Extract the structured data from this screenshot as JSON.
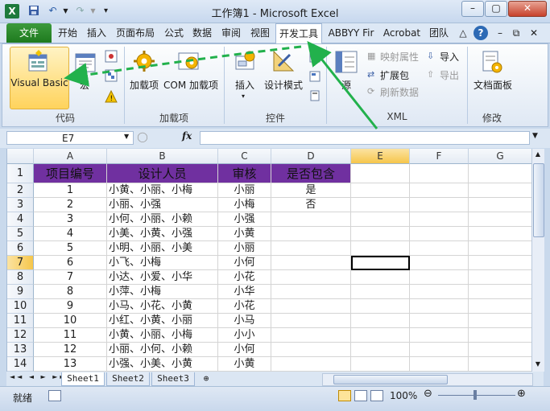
{
  "window": {
    "title": "工作簿1 - Microsoft Excel",
    "minimize": "–",
    "restore": "▢",
    "close": "✕"
  },
  "tabs": [
    "文件",
    "开始",
    "插入",
    "页面布局",
    "公式",
    "数据",
    "审阅",
    "视图",
    "开发工具",
    "ABBYY Fir",
    "Acrobat",
    "团队"
  ],
  "ribbon": {
    "groups": {
      "code": {
        "label": "代码",
        "visual_basic": "Visual Basic",
        "macros": "宏"
      },
      "addins": {
        "label": "加载项",
        "addins": "加载项",
        "com_addins": "COM 加载项"
      },
      "controls": {
        "label": "控件",
        "insert": "插入",
        "design_mode": "设计模式"
      },
      "xml": {
        "label": "XML",
        "source": "源",
        "map_properties": "映射属性",
        "expansion_packs": "扩展包",
        "refresh_data": "刷新数据",
        "import": "导入",
        "export": "导出"
      },
      "modify": {
        "label": "修改",
        "document_panel": "文档面板"
      }
    }
  },
  "formula_bar": {
    "name_box": "E7",
    "fx": "fx",
    "value": ""
  },
  "grid": {
    "columns": [
      "A",
      "B",
      "C",
      "D",
      "E",
      "F",
      "G"
    ],
    "rows": [
      "1",
      "2",
      "3",
      "4",
      "5",
      "6",
      "7",
      "8",
      "9",
      "10",
      "11",
      "12",
      "13",
      "14"
    ],
    "headers": [
      "项目编号",
      "设计人员",
      "审核",
      "是否包含"
    ],
    "data": [
      [
        "1",
        "小黄、小丽、小梅",
        "小丽",
        "是"
      ],
      [
        "2",
        "小丽、小强",
        "小梅",
        "否"
      ],
      [
        "3",
        "小何、小丽、小赖",
        "小强",
        ""
      ],
      [
        "4",
        "小美、小黄、小强",
        "小黄",
        ""
      ],
      [
        "5",
        "小明、小丽、小美",
        "小丽",
        ""
      ],
      [
        "6",
        "小飞、小梅",
        "小何",
        ""
      ],
      [
        "7",
        "小达、小爱、小华",
        "小花",
        ""
      ],
      [
        "8",
        "小萍、小梅",
        "小华",
        ""
      ],
      [
        "9",
        "小马、小花、小黄",
        "小花",
        ""
      ],
      [
        "10",
        "小红、小黄、小丽",
        "小马",
        ""
      ],
      [
        "11",
        "小黄、小丽、小梅",
        "小小",
        ""
      ],
      [
        "12",
        "小丽、小何、小赖",
        "小何",
        ""
      ],
      [
        "13",
        "小强、小美、小黄",
        "小黄",
        ""
      ]
    ],
    "selected_cell": "E7"
  },
  "sheets": [
    "Sheet1",
    "Sheet2",
    "Sheet3"
  ],
  "status": {
    "ready": "就绪",
    "zoom": "100%"
  },
  "colors": {
    "header_fill": "#7030a0",
    "annotation_arrow": "#22b14c"
  }
}
